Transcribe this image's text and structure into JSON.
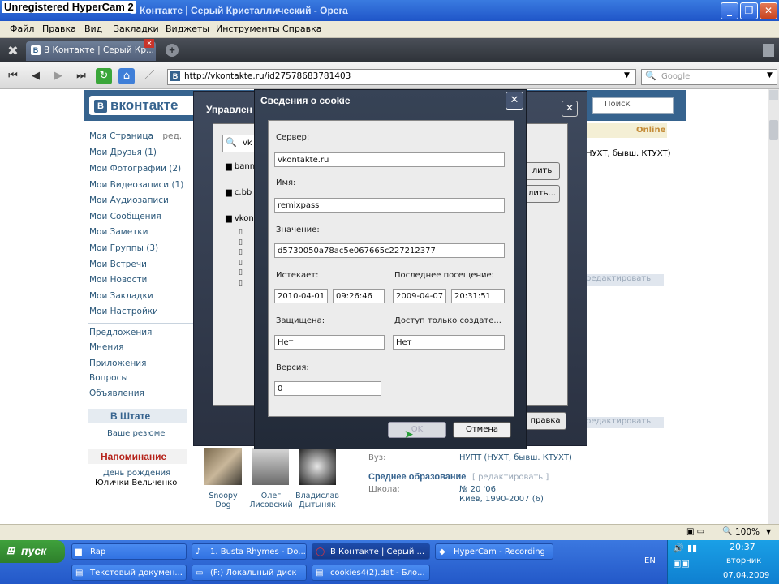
{
  "watermark": "Unregistered HyperCam 2",
  "window": {
    "title": "В Контакте | Серый Кристаллический - Opera"
  },
  "menu": [
    "Файл",
    "Правка",
    "Вид",
    "Закладки",
    "Виджеты",
    "Инструменты",
    "Справка"
  ],
  "tabs": [
    {
      "label": "В Контакте | Серый Кр..."
    }
  ],
  "address": {
    "url": "http://vkontakte.ru/id27578683781403",
    "search_placeholder": "Google"
  },
  "vk": {
    "logo": "вконтакте",
    "search_placeholder": "Поиск",
    "status": "Online",
    "profile_text": "НУХТ, бывш. КТУХТ)",
    "edit_link": "редактировать",
    "sidebar": [
      {
        "label": "Моя Страница",
        "suffix": "ред."
      },
      {
        "label": "Мои Друзья (1)"
      },
      {
        "label": "Мои Фотографии (2)"
      },
      {
        "label": "Мои Видеозаписи (1)"
      },
      {
        "label": "Мои Аудиозаписи"
      },
      {
        "label": "Мои Сообщения"
      },
      {
        "label": "Мои Заметки"
      },
      {
        "label": "Мои Группы (3)"
      },
      {
        "label": "Мои Встречи"
      },
      {
        "label": "Мои Новости"
      },
      {
        "label": "Мои Закладки"
      },
      {
        "label": "Мои Настройки"
      }
    ],
    "sidebar2": [
      "Предложения",
      "Мнения",
      "Приложения",
      "Вопросы",
      "Объявления"
    ],
    "v_shtate": "В Штате",
    "v_shtate_sub": "Ваше резюме",
    "reminder_title": "Напоминание",
    "reminder_line1": "День рождения",
    "reminder_line2": "Юлички Вельченко",
    "friends": [
      {
        "first": "Snoopy",
        "last": "Dog"
      },
      {
        "first": "Олег",
        "last": "Лисовский"
      },
      {
        "first": "Владислав",
        "last": "Дытыняк"
      }
    ],
    "uni_label": "Вуз:",
    "uni_value": "НУПТ (НУХТ, бывш. КТУХТ)",
    "secondary_title": "Среднее образование",
    "secondary_edit": "[ редактировать ]",
    "school_label": "Школа:",
    "school_value": "№ 20 '06",
    "school_city": "Киев, 1990-2007 (6)"
  },
  "cookie_manager": {
    "title": "Управлен",
    "search_value": "vk",
    "tree": [
      "bann",
      "c.bb",
      "vkon"
    ],
    "btn1": "лить",
    "btn2": "лить...",
    "btn_help": "правка"
  },
  "cookie_dialog": {
    "title": "Сведения о cookie",
    "server_label": "Сервер:",
    "server_value": "vkontakte.ru",
    "name_label": "Имя:",
    "name_value": "remixpass",
    "value_label": "Значение:",
    "value_value": "d5730050a78ac5e067665c227212377",
    "expires_label": "Истекает:",
    "expires_date": "2010-04-01",
    "expires_time": "09:26:46",
    "last_visit_label": "Последнее посещение:",
    "last_visit_date": "2009-04-07",
    "last_visit_time": "20:31:51",
    "secure_label": "Защищена:",
    "secure_value": "Нет",
    "creator_only_label": "Доступ только создате...",
    "creator_only_value": "Нет",
    "version_label": "Версия:",
    "version_value": "0",
    "ok": "OK",
    "cancel": "Отмена"
  },
  "zoom": "100%",
  "taskbar": {
    "start": "пуск",
    "row1": [
      "Rap",
      "1. Busta Rhymes - Do...",
      "В Контакте | Серый ...",
      "HyperCam - Recording"
    ],
    "row2": [
      "Текстовый докумен...",
      "(F:) Локальный диск",
      "cookies4(2).dat - Бло..."
    ],
    "lang": "EN",
    "time": "20:37",
    "day": "вторник",
    "date": "07.04.2009"
  }
}
